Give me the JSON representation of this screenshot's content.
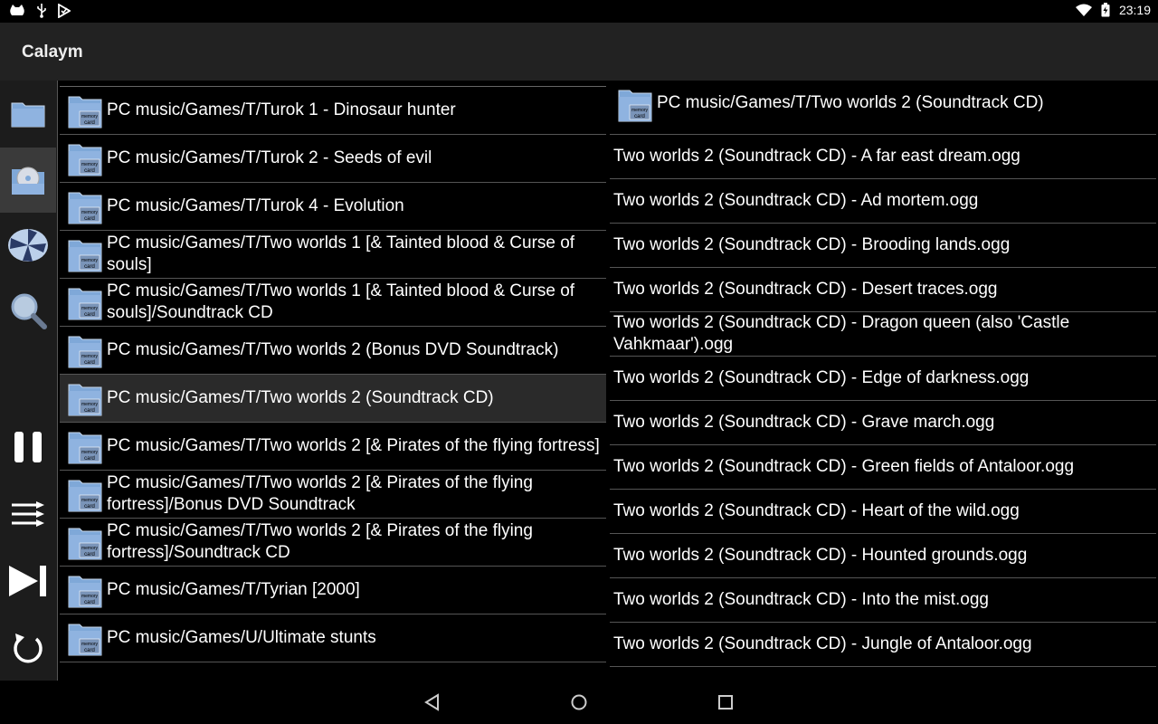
{
  "status_bar": {
    "time": "23:19",
    "left_icons": [
      "cat-icon",
      "usb-icon",
      "media-check-icon"
    ],
    "right_icons": [
      "wifi-icon",
      "battery-icon"
    ]
  },
  "app": {
    "title": "Calaym"
  },
  "sidebar": {
    "nav": [
      {
        "icon": "folder-icon",
        "active": false
      },
      {
        "icon": "disc-icon",
        "active": true
      },
      {
        "icon": "pinwheel-icon",
        "active": false
      },
      {
        "icon": "magnifier-icon",
        "active": false
      }
    ],
    "controls": [
      "pause-icon",
      "queue-icon",
      "skip-next-icon",
      "repeat-icon"
    ]
  },
  "left_list": {
    "items": [
      {
        "label": "PC music/Games/T/Turok 1 - Dinosaur hunter",
        "selected": false
      },
      {
        "label": "PC music/Games/T/Turok 2 - Seeds of evil",
        "selected": false
      },
      {
        "label": "PC music/Games/T/Turok 4 - Evolution",
        "selected": false
      },
      {
        "label": "PC music/Games/T/Two worlds 1 [& Tainted blood & Curse of souls]",
        "selected": false
      },
      {
        "label": "PC music/Games/T/Two worlds 1 [& Tainted blood & Curse of souls]/Soundtrack CD",
        "selected": false
      },
      {
        "label": "PC music/Games/T/Two worlds 2 (Bonus DVD Soundtrack)",
        "selected": false
      },
      {
        "label": "PC music/Games/T/Two worlds 2 (Soundtrack CD)",
        "selected": true
      },
      {
        "label": "PC music/Games/T/Two worlds 2 [& Pirates of the flying fortress]",
        "selected": false
      },
      {
        "label": "PC music/Games/T/Two worlds 2 [& Pirates of the flying fortress]/Bonus DVD Soundtrack",
        "selected": false
      },
      {
        "label": "PC music/Games/T/Two worlds 2 [& Pirates of the flying fortress]/Soundtrack CD",
        "selected": false
      },
      {
        "label": "PC music/Games/T/Tyrian [2000]",
        "selected": false
      },
      {
        "label": "PC music/Games/U/Ultimate stunts",
        "selected": false
      }
    ],
    "folder_badge": "memory card"
  },
  "right_list": {
    "header": "PC music/Games/T/Two worlds 2 (Soundtrack CD)",
    "tracks": [
      "Two worlds 2 (Soundtrack CD) - A far east dream.ogg",
      "Two worlds 2 (Soundtrack CD) - Ad mortem.ogg",
      "Two worlds 2 (Soundtrack CD) - Brooding lands.ogg",
      "Two worlds 2 (Soundtrack CD) - Desert traces.ogg",
      "Two worlds 2 (Soundtrack CD) - Dragon queen (also 'Castle Vahkmaar').ogg",
      "Two worlds 2 (Soundtrack CD) - Edge of darkness.ogg",
      "Two worlds 2 (Soundtrack CD) - Grave march.ogg",
      "Two worlds 2 (Soundtrack CD) - Green fields of Antaloor.ogg",
      "Two worlds 2 (Soundtrack CD) - Heart of the wild.ogg",
      "Two worlds 2 (Soundtrack CD) - Hounted grounds.ogg",
      "Two worlds 2 (Soundtrack CD) - Into the mist.ogg",
      "Two worlds 2 (Soundtrack CD) - Jungle of Antaloor.ogg"
    ]
  },
  "nav_bar": [
    "back-icon",
    "home-icon",
    "recents-icon"
  ],
  "colors": {
    "appbar": "#222222",
    "background": "#000000",
    "selected_row": "#2a2a2a",
    "folder": "#8fb3e0"
  }
}
